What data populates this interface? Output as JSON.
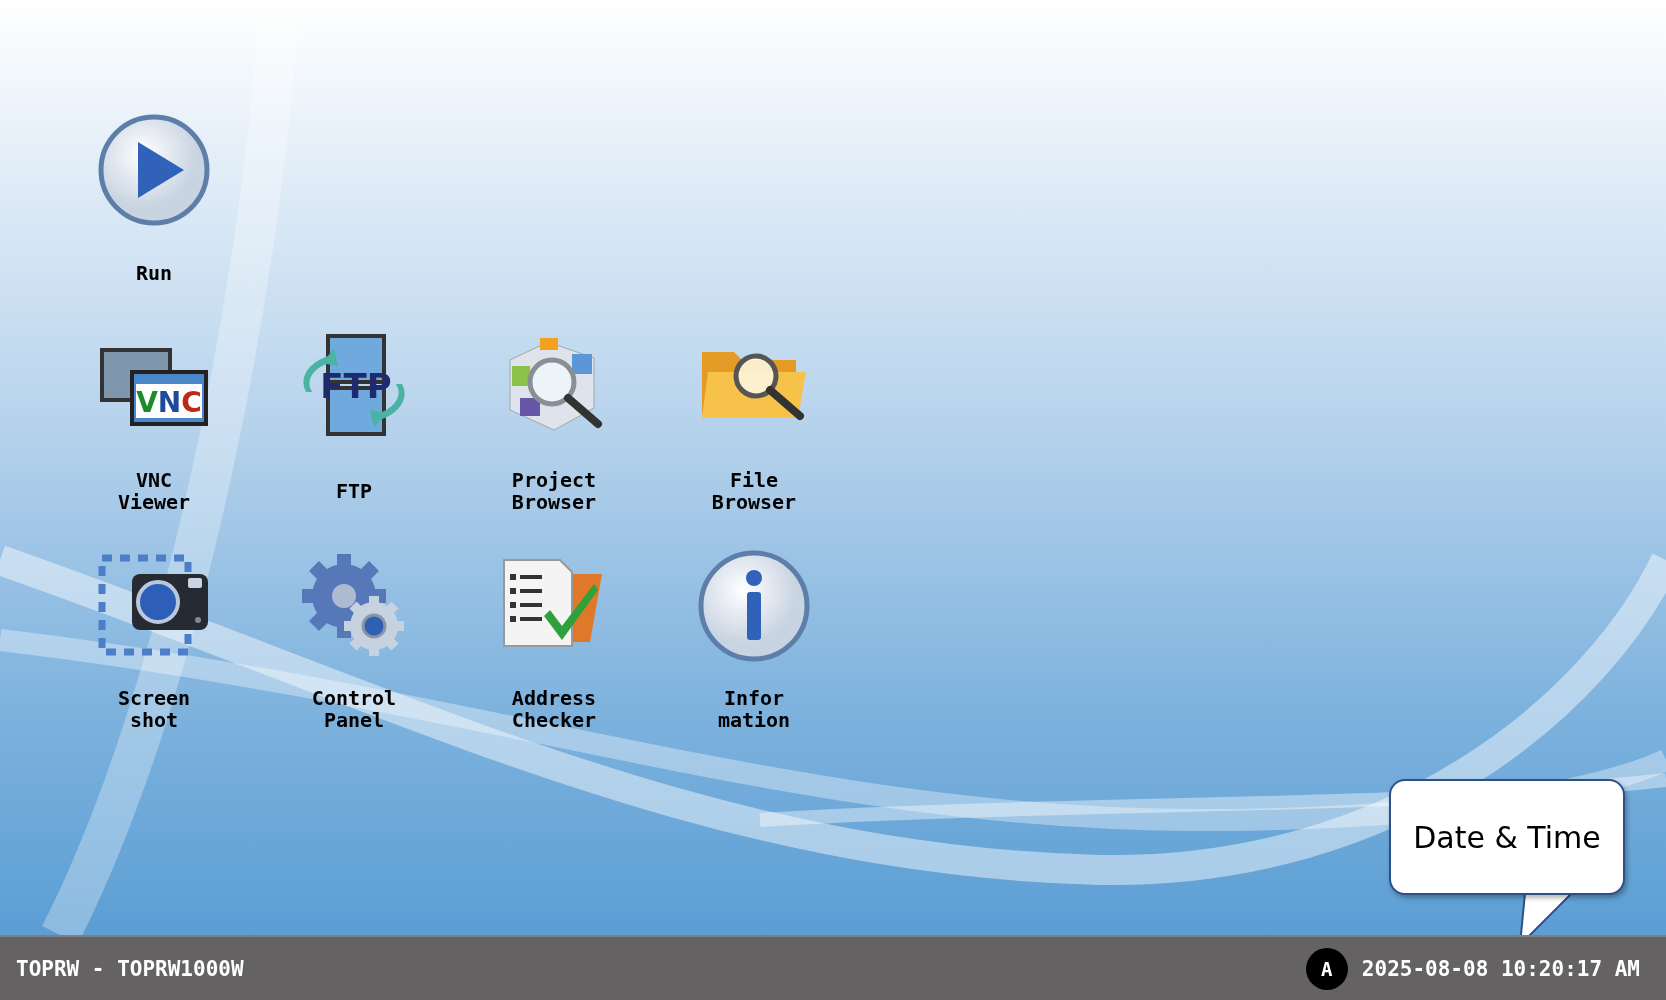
{
  "desktop": {
    "icon_rows": [
      [
        {
          "kind": "run",
          "label_lines": [
            "Run"
          ]
        }
      ],
      [
        {
          "kind": "vnc",
          "icon_text": "VNC",
          "label_lines": [
            "VNC",
            "Viewer"
          ]
        },
        {
          "kind": "ftp",
          "icon_text": "FTP",
          "label_lines": [
            "FTP"
          ]
        },
        {
          "kind": "project",
          "label_lines": [
            "Project",
            "Browser"
          ]
        },
        {
          "kind": "file",
          "label_lines": [
            "File",
            "Browser"
          ]
        }
      ],
      [
        {
          "kind": "screenshot",
          "label_lines": [
            "Screen",
            "shot"
          ]
        },
        {
          "kind": "control",
          "label_lines": [
            "Control",
            "Panel"
          ]
        },
        {
          "kind": "address",
          "label_lines": [
            "Address",
            "Checker"
          ]
        },
        {
          "kind": "info",
          "label_lines": [
            "Infor",
            "mation"
          ]
        }
      ]
    ]
  },
  "callout": {
    "text": "Date & Time"
  },
  "taskbar": {
    "model": "TOPRW - TOPRW1000W",
    "input_mode": "A",
    "datetime": "2025-08-08 10:20:17 AM"
  }
}
